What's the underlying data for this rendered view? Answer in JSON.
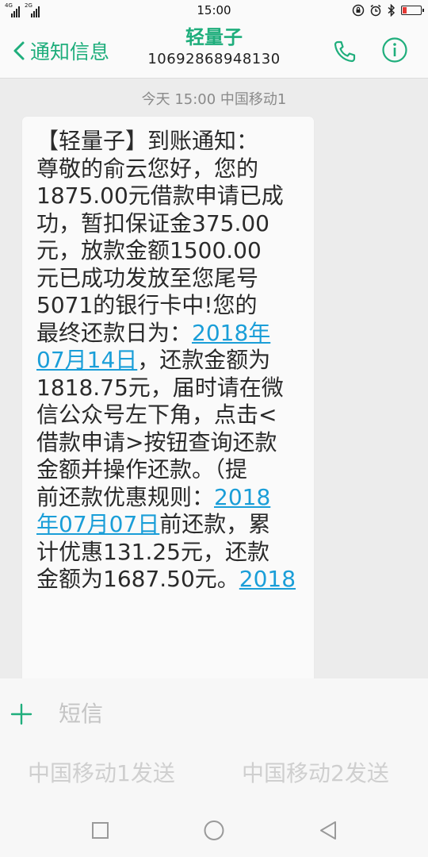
{
  "status_bar": {
    "network1": "4G",
    "network2": "2G",
    "time": "15:00"
  },
  "header": {
    "back_label": "通知信息",
    "contact_name": "轻量子",
    "contact_number": "10692868948130"
  },
  "conversation": {
    "timestamp": "今天 15:00  中国移动1",
    "message": {
      "line1": "【轻量子】到账通知：",
      "line2": "尊敬的俞云您好，您的",
      "line3": "1875.00元借款申请已成",
      "line4": "功，暂扣保证金375.00",
      "line5": "元，放款金额1500.00",
      "line6": "元已成功发放至您尾号",
      "line7": "5071的银行卡中!您的",
      "line8_pre": "最终还款日为：",
      "link1_a": "2018年",
      "link1_b": "07月14日",
      "line9_post": "，还款金额为",
      "line10": "1818.75元，届时请在微",
      "line11": "信公众号左下角，点击<",
      "line12": "借款申请>按钮查询还款",
      "line13": "金额并操作还款。（提",
      "line14_pre": "前还款优惠规则：",
      "link2_a": "2018",
      "link2_b": "年07月07日",
      "line15_post": "前还款，累",
      "line16": "计优惠131.25元，还款",
      "line17_pre": "金额为1687.50元。",
      "link3_a": "2018"
    }
  },
  "compose": {
    "placeholder": "短信",
    "send_sim1": "中国移动1发送",
    "send_sim2": "中国移动2发送"
  },
  "colors": {
    "accent": "#1fae7c",
    "link": "#1a9ed8",
    "battery_low": "#e53935"
  }
}
